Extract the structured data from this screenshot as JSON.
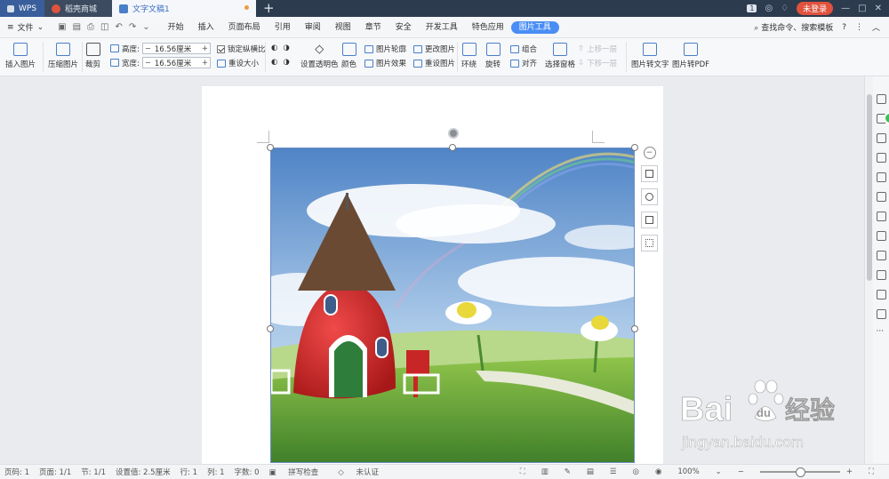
{
  "tabs": {
    "wps": "WPS",
    "store": "稻壳商城",
    "doc": "文字文稿1",
    "new": "+"
  },
  "titlebar": {
    "badge": "1",
    "login": "未登录",
    "min": "—",
    "max": "□",
    "close": "✕"
  },
  "menubar": {
    "file": "文件",
    "items": [
      "开始",
      "插入",
      "页面布局",
      "引用",
      "审阅",
      "视图",
      "章节",
      "安全",
      "开发工具",
      "特色应用",
      "图片工具"
    ],
    "active": "图片工具",
    "search": "查找命令、搜索模板",
    "help": "?",
    "more": "︿"
  },
  "ribbon": {
    "insert_picture": "插入图片",
    "compress_picture": "压缩图片",
    "crop": "裁剪",
    "height_label": "高度:",
    "height_value": "16.56厘米",
    "width_label": "宽度:",
    "width_value": "16.56厘米",
    "lock_ratio": "锁定纵横比",
    "reset_size": "重设大小",
    "set_transparent": "设置透明色",
    "color": "颜色",
    "picture_outline": "图片轮廓",
    "picture_effect": "图片效果",
    "change_picture": "更改图片",
    "reset_picture": "重设图片",
    "wrap": "环绕",
    "rotate": "旋转",
    "group": "组合",
    "align": "对齐",
    "selection_pane": "选择窗格",
    "bring_forward": "上移一层",
    "send_backward": "下移一层",
    "to_text": "图片转文字",
    "to_pdf": "图片转PDF",
    "minus": "−",
    "plus": "+"
  },
  "statusbar": {
    "page_no": "页码: 1",
    "pages": "页面: 1/1",
    "section": "节: 1/1",
    "setting": "设置值: 2.5厘米",
    "row": "行: 1",
    "col": "列: 1",
    "words": "字数: 0",
    "spell": "拼写检查",
    "cert": "未认证",
    "zoom": "100%",
    "zoom_minus": "−",
    "zoom_plus": "+"
  },
  "watermark": {
    "brand": "Bai",
    "paw": "du",
    "cn": "经验",
    "url": "jingyan.baidu.com"
  },
  "colors": {
    "accent": "#4a8ef5",
    "titlebar": "#2d3b4e",
    "login": "#e0523d"
  }
}
